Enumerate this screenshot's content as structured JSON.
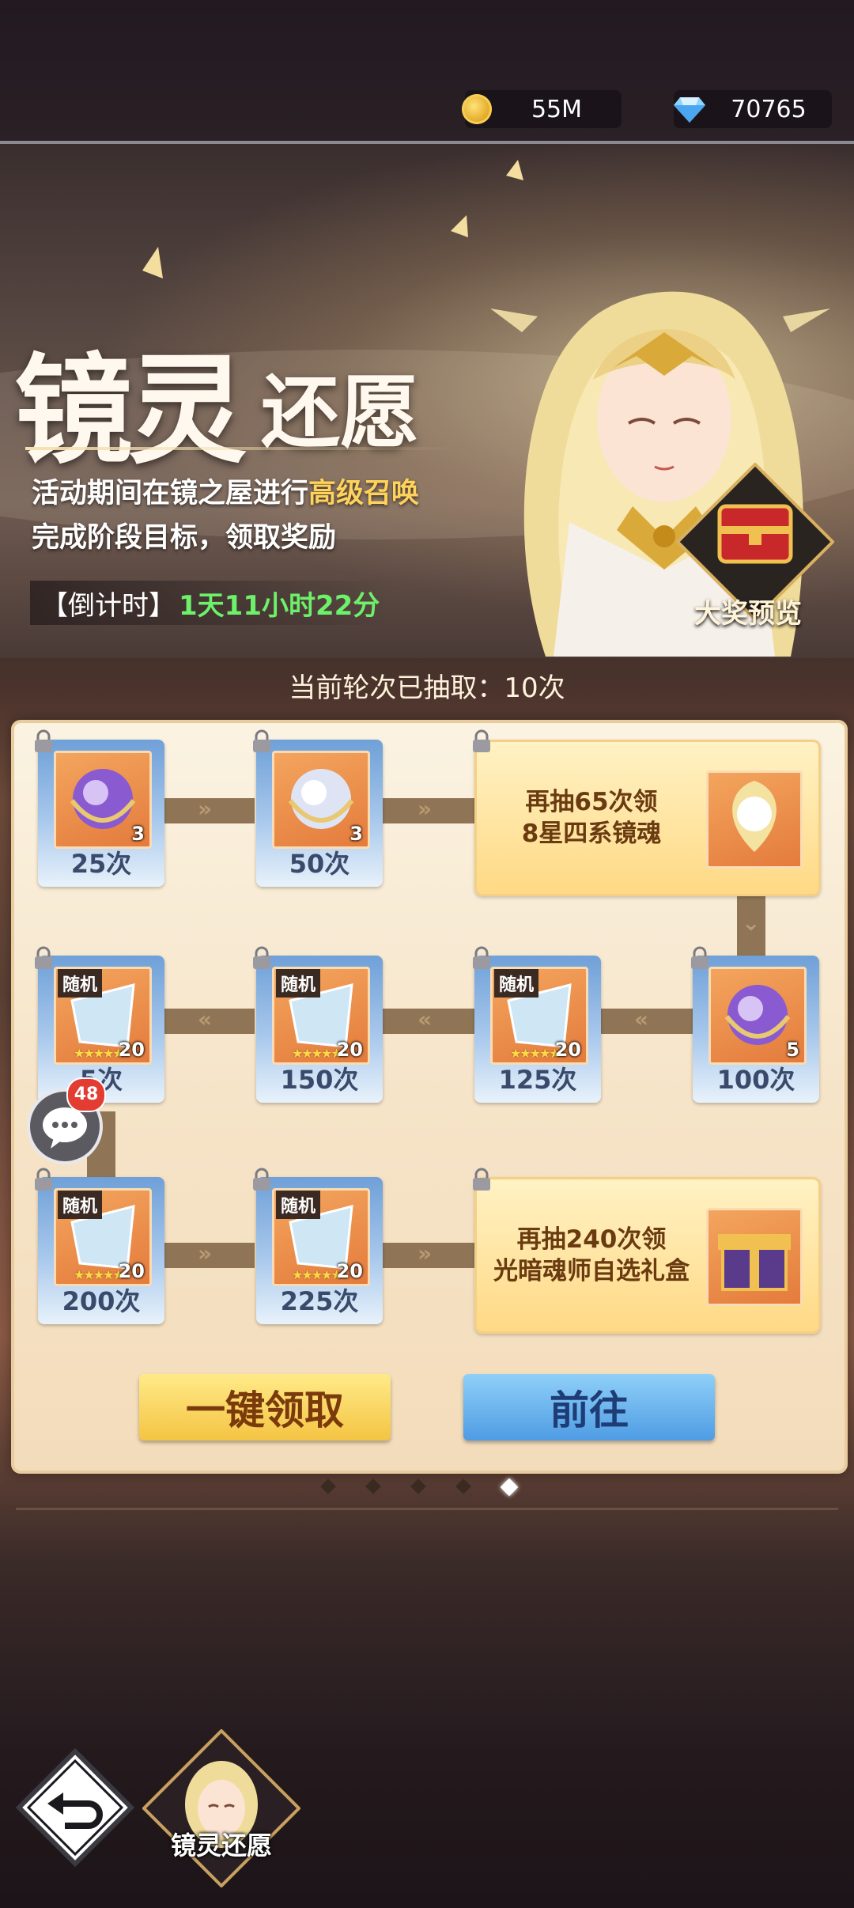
{
  "resources": {
    "gold": "55M",
    "diamonds": "70765"
  },
  "banner": {
    "title_main": "镜灵",
    "title_sub": "还愿",
    "desc_line1_pre": "活动期间在镜之屋进行",
    "desc_line1_hl": "高级召唤",
    "desc_line2": "完成阶段目标，领取奖励",
    "countdown_label": "【倒计时】",
    "countdown_value": "1天11小时22分",
    "grand_prize_label": "大奖预览"
  },
  "draws_header": "当前轮次已抽取：10次",
  "milestones": {
    "row1": [
      {
        "label": "25次",
        "count": "3"
      },
      {
        "label": "50次",
        "count": "3"
      }
    ],
    "goal1": {
      "line1": "再抽65次领",
      "line2": "8星四系镜魂"
    },
    "row2": [
      {
        "label": "5次",
        "count": "20",
        "tag": "随机"
      },
      {
        "label": "150次",
        "count": "20",
        "tag": "随机"
      },
      {
        "label": "125次",
        "count": "20",
        "tag": "随机"
      },
      {
        "label": "100次",
        "count": "5"
      }
    ],
    "row3": [
      {
        "label": "200次",
        "count": "20",
        "tag": "随机"
      },
      {
        "label": "225次",
        "count": "20",
        "tag": "随机"
      }
    ],
    "goal2": {
      "line1": "再抽240次领",
      "line2": "光暗魂师自选礼盒"
    }
  },
  "buttons": {
    "claim_all": "一键领取",
    "go": "前往"
  },
  "pagination": {
    "total": 5,
    "active": 5
  },
  "chat_badge": "48",
  "event_tab_label": "镜灵还愿",
  "colors": {
    "accent_gold": "#ffd35a",
    "countdown_green": "#6df06a",
    "badge_red": "#e33c32"
  }
}
